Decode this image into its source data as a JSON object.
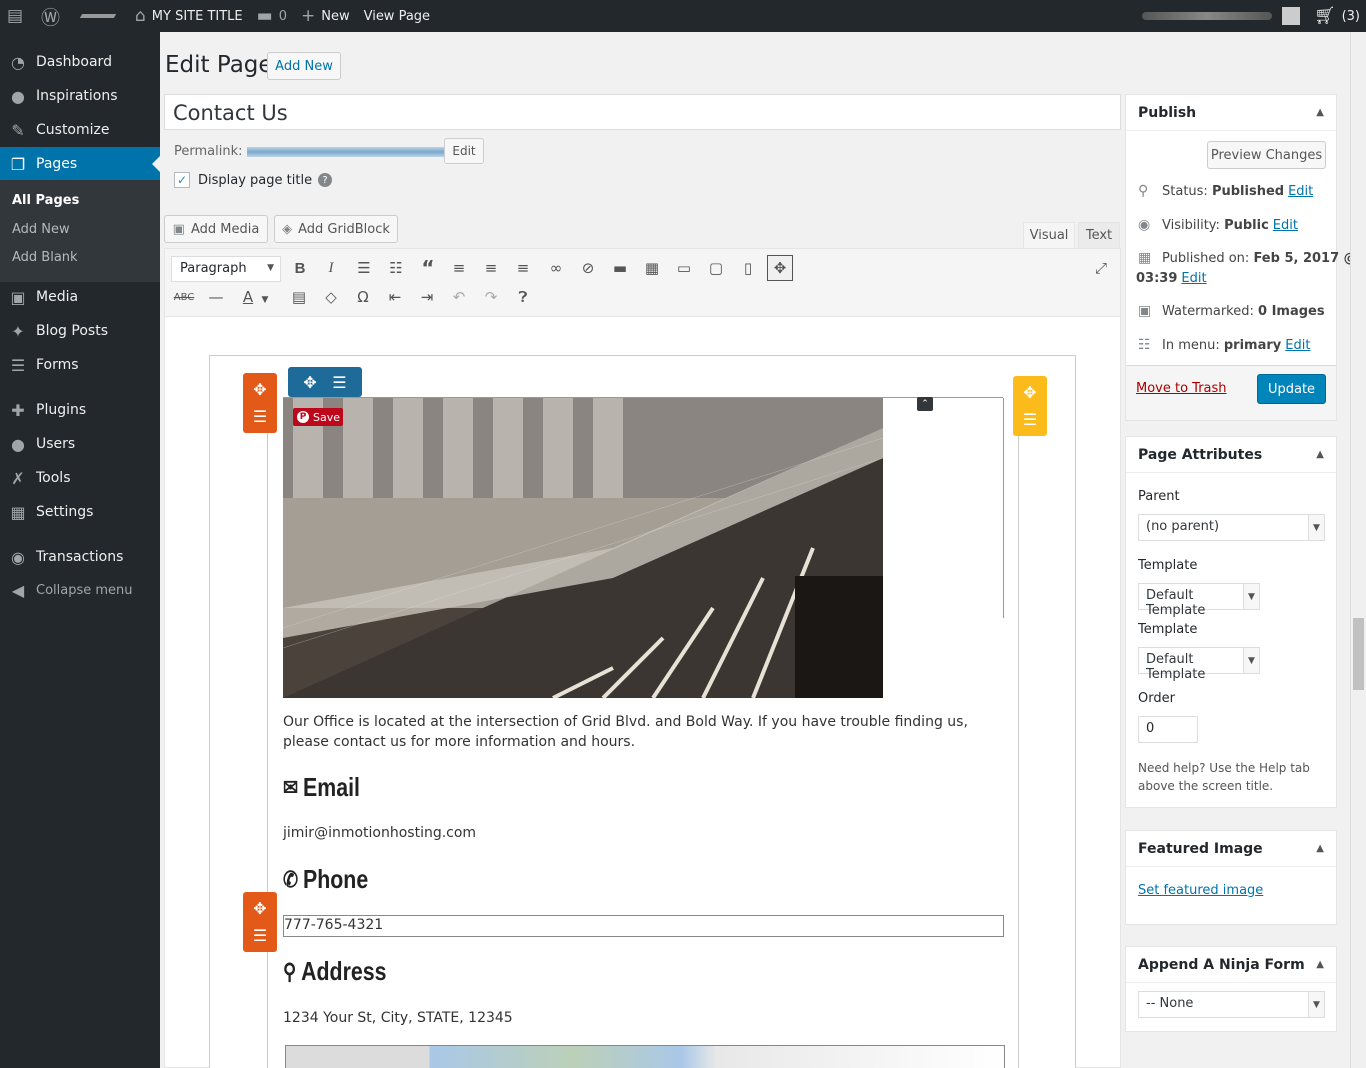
{
  "adminbar": {
    "site_title": "MY SITE TITLE",
    "comments_count": "0",
    "new_label": "New",
    "view_page": "View Page",
    "cart_count": "(3)"
  },
  "sidebar": {
    "items": [
      {
        "label": "Dashboard",
        "icon": "dashboard-icon"
      },
      {
        "label": "Inspirations",
        "icon": "lightbulb-icon"
      },
      {
        "label": "Customize",
        "icon": "brush-icon"
      },
      {
        "label": "Pages",
        "icon": "pages-icon"
      },
      {
        "label": "Media",
        "icon": "media-icon"
      },
      {
        "label": "Blog Posts",
        "icon": "pin-icon"
      },
      {
        "label": "Forms",
        "icon": "forms-icon"
      },
      {
        "label": "Plugins",
        "icon": "plugin-icon"
      },
      {
        "label": "Users",
        "icon": "user-icon"
      },
      {
        "label": "Tools",
        "icon": "wrench-icon"
      },
      {
        "label": "Settings",
        "icon": "settings-icon"
      },
      {
        "label": "Transactions",
        "icon": "transactions-icon"
      },
      {
        "label": "Collapse menu",
        "icon": "collapse-icon"
      }
    ],
    "submenu": [
      "All Pages",
      "Add New",
      "Add Blank"
    ]
  },
  "header": {
    "title": "Edit Page",
    "add_new": "Add New"
  },
  "editor": {
    "post_title": "Contact Us",
    "permalink_label": "Permalink:",
    "permalink_edit": "Edit",
    "display_title_label": "Display page title",
    "add_media": "Add Media",
    "add_gridblock": "Add GridBlock",
    "tab_visual": "Visual",
    "tab_text": "Text",
    "format": "Paragraph",
    "pin_save": "Save"
  },
  "content": {
    "intro": "Our Office is located at the intersection of Grid Blvd. and Bold Way. If you have trouble finding us, please contact us for more information and hours.",
    "email_heading": "Email",
    "email": "jimir@inmotionhosting.com",
    "phone_heading": "Phone",
    "phone": "777-765-4321",
    "address_heading": "Address",
    "address": "1234 Your St, City, STATE, 12345"
  },
  "publish": {
    "title": "Publish",
    "preview": "Preview Changes",
    "status_label": "Status:",
    "status_value": "Published",
    "visibility_label": "Visibility:",
    "visibility_value": "Public",
    "published_on": "Published on:",
    "published_date": "Feb 5, 2017 @",
    "published_time": "03:39",
    "watermarked_label": "Watermarked:",
    "watermarked_value": "0 Images",
    "menu_label": "In menu:",
    "menu_value": "primary",
    "edit": "Edit",
    "trash": "Move to Trash",
    "update": "Update"
  },
  "attributes": {
    "title": "Page Attributes",
    "parent_label": "Parent",
    "parent_value": "(no parent)",
    "template_label": "Template",
    "template_value": "Default Template",
    "template2_label": "Template",
    "template2_value": "Default Template",
    "order_label": "Order",
    "order_value": "0",
    "help": "Need help? Use the Help tab above the screen title."
  },
  "featured": {
    "title": "Featured Image",
    "link": "Set featured image"
  },
  "ninja": {
    "title": "Append A Ninja Form",
    "value": "-- None"
  },
  "colors": {
    "adminbar": "#23282d",
    "accent": "#0073aa",
    "primary_button": "#0085ba",
    "handle_orange": "#e35a18",
    "handle_yellow": "#fbbc1b",
    "handle_blue": "#1e6b9a",
    "pinterest": "#bd081c"
  }
}
